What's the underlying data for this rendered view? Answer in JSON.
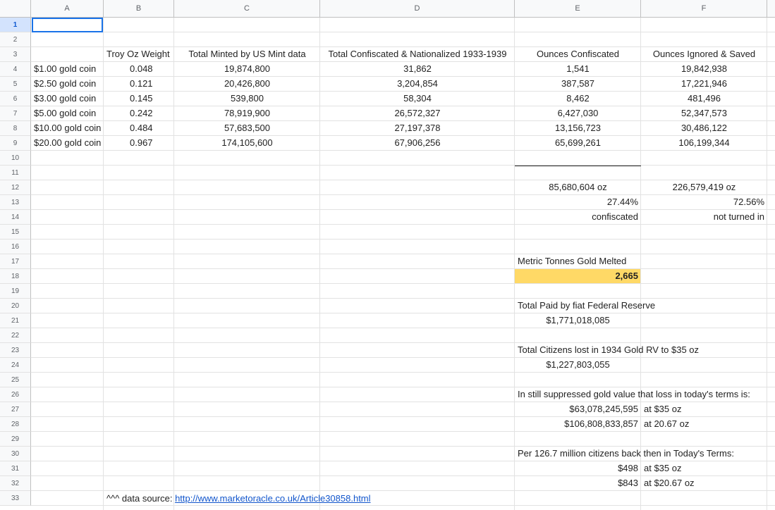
{
  "columns": [
    "A",
    "B",
    "C",
    "D",
    "E",
    "F"
  ],
  "rows": [
    "1",
    "2",
    "3",
    "4",
    "5",
    "6",
    "7",
    "8",
    "9",
    "10",
    "11",
    "12",
    "13",
    "14",
    "15",
    "16",
    "17",
    "18",
    "19",
    "20",
    "21",
    "22",
    "23",
    "24",
    "25",
    "26",
    "27",
    "28",
    "29",
    "30",
    "31",
    "32",
    "33"
  ],
  "headers": {
    "b": "Troy Oz Weight",
    "c": "Total Minted by US Mint data",
    "d": "Total Confiscated & Nationalized 1933-1939",
    "e": "Ounces Confiscated",
    "f": "Ounces Ignored & Saved"
  },
  "table": [
    {
      "coin": "$1.00 gold coin",
      "weight": "0.048",
      "minted": "19,874,800",
      "confiscated": "31,862",
      "oz_conf": "1,541",
      "oz_saved": "19,842,938"
    },
    {
      "coin": "$2.50 gold coin",
      "weight": "0.121",
      "minted": "20,426,800",
      "confiscated": "3,204,854",
      "oz_conf": "387,587",
      "oz_saved": "17,221,946"
    },
    {
      "coin": "$3.00 gold coin",
      "weight": "0.145",
      "minted": "539,800",
      "confiscated": "58,304",
      "oz_conf": "8,462",
      "oz_saved": "481,496"
    },
    {
      "coin": "$5.00 gold coin",
      "weight": "0.242",
      "minted": "78,919,900",
      "confiscated": "26,572,327",
      "oz_conf": "6,427,030",
      "oz_saved": "52,347,573"
    },
    {
      "coin": "$10.00 gold coin",
      "weight": "0.484",
      "minted": "57,683,500",
      "confiscated": "27,197,378",
      "oz_conf": "13,156,723",
      "oz_saved": "30,486,122"
    },
    {
      "coin": "$20.00 gold coin",
      "weight": "0.967",
      "minted": "174,105,600",
      "confiscated": "67,906,256",
      "oz_conf": "65,699,261",
      "oz_saved": "106,199,344"
    }
  ],
  "totals": {
    "e12": "85,680,604 oz",
    "f12": "226,579,419 oz",
    "e13": "27.44%",
    "f13": "72.56%",
    "e14": "confiscated",
    "f14": "not turned in"
  },
  "notes": {
    "e17": "Metric Tonnes Gold Melted",
    "e18": "2,665",
    "e20": "Total Paid by fiat Federal Reserve",
    "e21": "$1,771,018,085",
    "e23": "Total Citizens lost in 1934 Gold RV to $35 oz",
    "e24": "$1,227,803,055",
    "e26": "In still suppressed gold value that loss in today's terms is:",
    "e27": "$63,078,245,595",
    "f27": "at $35 oz",
    "e28": "$106,808,833,857",
    "f28": "at 20.67 oz",
    "e30": "Per 126.7 million citizens back then in Today's Terms:",
    "e31": "$498",
    "f31": "at $35 oz",
    "e32": "$843",
    "f32": "at $20.67 oz"
  },
  "source": {
    "prefix": "^^^ data source: ",
    "link": "http://www.marketoracle.co.uk/Article30858.html"
  },
  "colors": {
    "highlight": "#ffd966",
    "selection": "#1a73e8",
    "link": "#1155cc"
  }
}
